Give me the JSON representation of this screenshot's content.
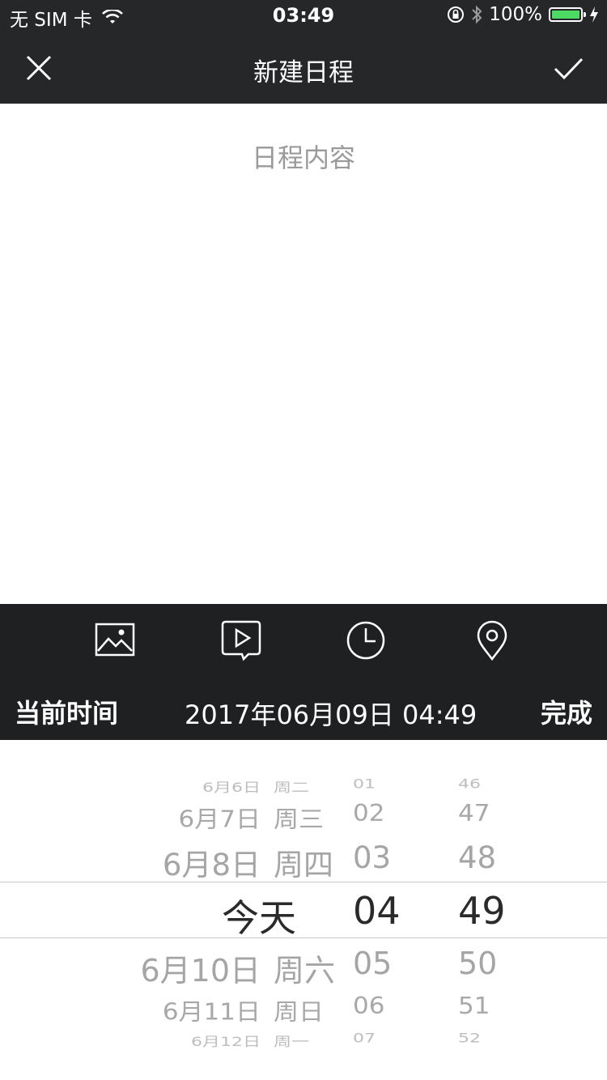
{
  "status_bar": {
    "carrier": "无 SIM 卡",
    "time": "03:49",
    "battery": "100%",
    "icons": [
      "wifi-icon",
      "orientation-lock-icon",
      "bluetooth-icon",
      "battery-icon",
      "charging-icon"
    ]
  },
  "nav": {
    "title": "新建日程",
    "close_icon": "close-icon",
    "confirm_icon": "checkmark-icon"
  },
  "content": {
    "placeholder": "日程内容"
  },
  "toolbar": {
    "items": [
      "image-icon",
      "video-icon",
      "clock-icon",
      "location-icon"
    ]
  },
  "time_bar": {
    "current_label": "当前时间",
    "datetime": "2017年06月09日 04:49",
    "done_label": "完成"
  },
  "picker": {
    "rows": [
      {
        "date": "6月6日",
        "weekday": "周二",
        "hour": "01",
        "minute": "46"
      },
      {
        "date": "6月7日",
        "weekday": "周三",
        "hour": "02",
        "minute": "47"
      },
      {
        "date": "6月8日",
        "weekday": "周四",
        "hour": "03",
        "minute": "48"
      },
      {
        "date": "今天",
        "weekday": "",
        "hour": "04",
        "minute": "49"
      },
      {
        "date": "6月10日",
        "weekday": "周六",
        "hour": "05",
        "minute": "50"
      },
      {
        "date": "6月11日",
        "weekday": "周日",
        "hour": "06",
        "minute": "51"
      },
      {
        "date": "6月12日",
        "weekday": "周一",
        "hour": "07",
        "minute": "52"
      }
    ],
    "selected_index": 3
  }
}
